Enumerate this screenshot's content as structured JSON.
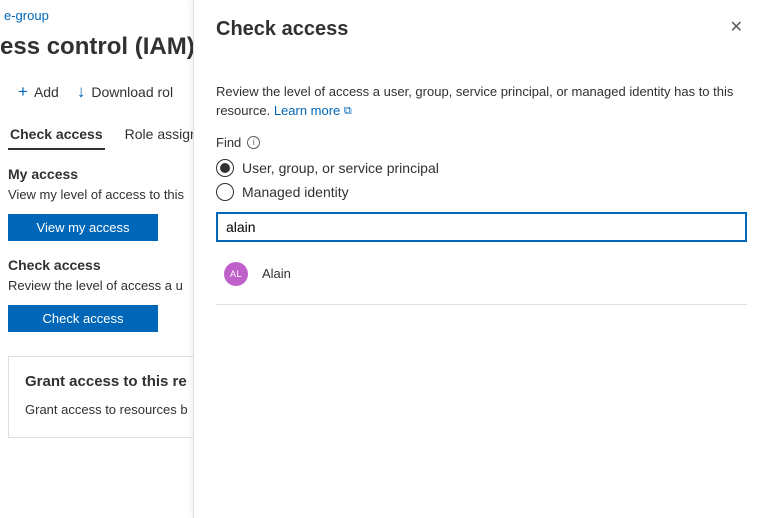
{
  "breadcrumb": {
    "text": "e-group"
  },
  "page": {
    "title": "ess control (IAM)"
  },
  "cmdbar": {
    "add": {
      "icon": "+",
      "label": "Add"
    },
    "download": {
      "icon": "↓",
      "label": "Download rol"
    }
  },
  "tabs": [
    {
      "label": "Check access",
      "active": true
    },
    {
      "label": "Role assign",
      "active": false
    }
  ],
  "my_access": {
    "heading": "My access",
    "desc": "View my level of access to this",
    "button": "View my access"
  },
  "check_access_section": {
    "heading": "Check access",
    "desc": "Review the level of access a u",
    "button": "Check access"
  },
  "grant_card": {
    "heading": "Grant access to this re",
    "desc": "Grant access to resources b"
  },
  "flyout": {
    "title": "Check access",
    "description": "Review the level of access a user, group, service principal, or managed identity has to this resource. ",
    "learn_more": "Learn more",
    "find_label": "Find",
    "radios": [
      {
        "label": "User, group, or service principal",
        "selected": true
      },
      {
        "label": "Managed identity",
        "selected": false
      }
    ],
    "search_value": "alain",
    "results": [
      {
        "initials": "AL",
        "name": "Alain"
      }
    ]
  }
}
